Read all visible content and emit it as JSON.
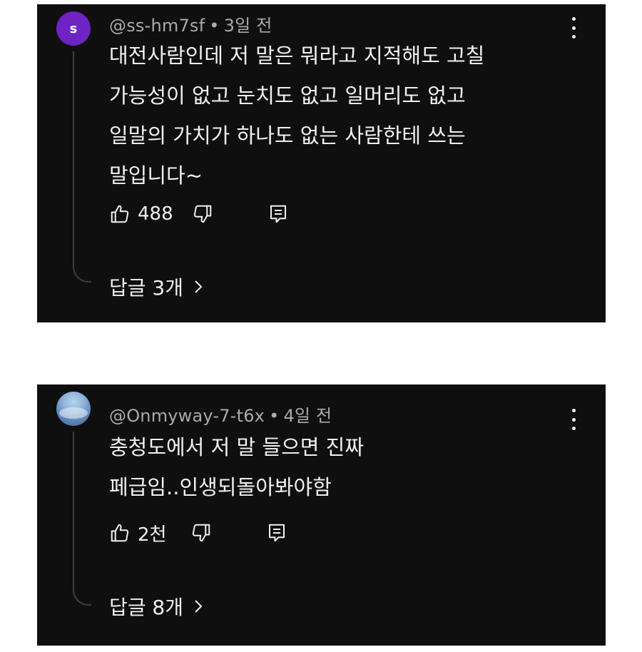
{
  "comments": [
    {
      "avatar_letter": "s",
      "avatar_color": "#6e23c2",
      "username": "@ss-hm7sf",
      "separator": "•",
      "time": "3일 전",
      "text_lines": [
        "대전사람인데 저 말은 뭐라고 지적해도 고칠",
        "가능성이 없고 눈치도 없고 일머리도 없고",
        "일말의 가치가 하나도 없는 사람한테 쓰는",
        "말입니다~"
      ],
      "likes": "488",
      "replies_label": "답글 3개",
      "icons": [
        "like-icon",
        "dislike-icon",
        "reply-icon",
        "more-vert-icon",
        "chevron-right-icon"
      ]
    },
    {
      "avatar_image": "sky-photo",
      "username": "@Onmyway-7-t6x",
      "separator": "•",
      "time": "4일 전",
      "text_lines": [
        "충청도에서 저 말 들으면 진짜",
        "페급임..인생되돌아봐야함"
      ],
      "likes": "2천",
      "replies_label": "답글 8개",
      "icons": [
        "like-icon",
        "dislike-icon",
        "reply-icon",
        "more-vert-icon",
        "chevron-right-icon"
      ]
    }
  ],
  "colors": {
    "card_background": "#0f0f0f",
    "text_primary": "#f1f1f1",
    "text_secondary": "#aaaaaa",
    "page_background": "#ffffff"
  }
}
